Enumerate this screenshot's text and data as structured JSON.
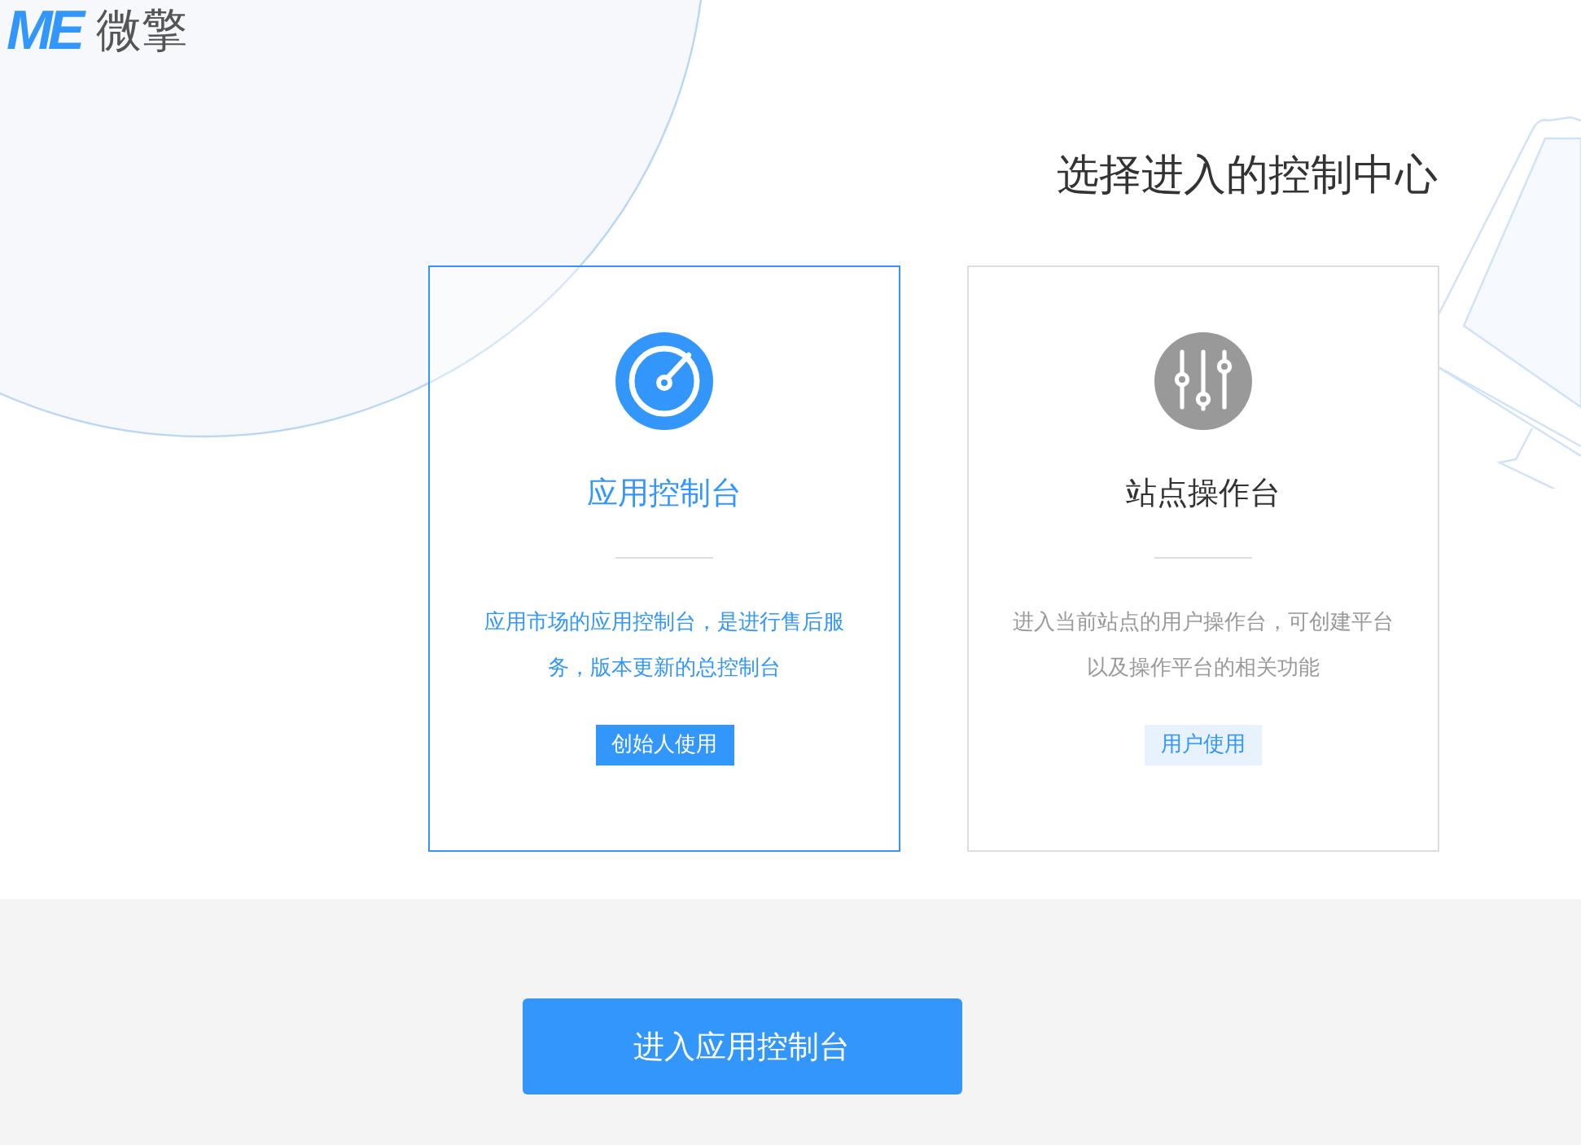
{
  "header": {
    "logo_mark": "ME",
    "brand_name": "微擎"
  },
  "heading": "选择进入的控制中心",
  "cards": [
    {
      "kind": "app",
      "title": "应用控制台",
      "description": "应用市场的应用控制台，是进行售后服务，版本更新的总控制台",
      "badge": "创始人使用",
      "selected": true
    },
    {
      "kind": "site",
      "title": "站点操作台",
      "description": "进入当前站点的用户操作台，可创建平台以及操作平台的相关功能",
      "badge": "用户使用",
      "selected": false
    }
  ],
  "enter_button": "进入应用控制台"
}
